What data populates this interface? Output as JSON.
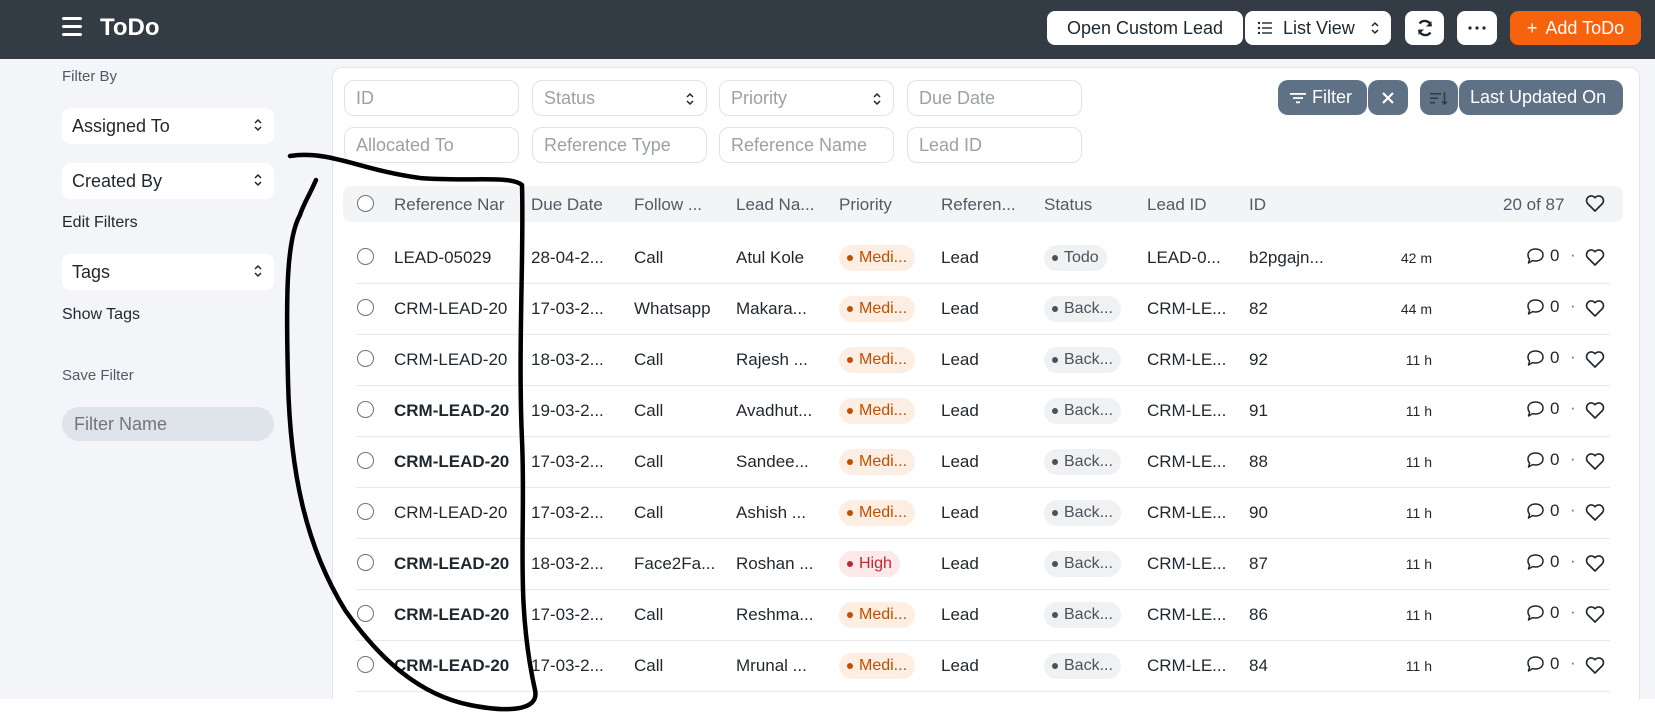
{
  "header": {
    "title": "ToDo",
    "open_custom_lead": "Open Custom Lead",
    "list_view": "List View",
    "add_todo": "Add ToDo",
    "add_icon": "+"
  },
  "sidebar": {
    "filter_by": "Filter By",
    "assigned_to": "Assigned To",
    "created_by": "Created By",
    "edit_filters": "Edit Filters",
    "tags": "Tags",
    "show_tags": "Show Tags",
    "save_filter": "Save Filter",
    "filter_name_placeholder": "Filter Name"
  },
  "filters": {
    "id": "ID",
    "status": "Status",
    "priority": "Priority",
    "due_date": "Due Date",
    "allocated_to": "Allocated To",
    "reference_type": "Reference Type",
    "reference_name": "Reference Name",
    "lead_id": "Lead ID",
    "filter_button": "Filter",
    "sort_label": "Last Updated On"
  },
  "table": {
    "columns": [
      "Reference Nar",
      "Due Date",
      "Follow ...",
      "Lead Na...",
      "Priority",
      "Referen...",
      "Status",
      "Lead ID",
      "ID"
    ],
    "count": "20 of 87",
    "rows": [
      {
        "ref": "LEAD-05029",
        "bold": false,
        "due": "28-04-2...",
        "follow": "Call",
        "lead": "Atul Kole",
        "priority": "Medi...",
        "pri_level": "med",
        "reftype": "Lead",
        "status": "Todo",
        "leadid": "LEAD-0...",
        "id": "b2pgajn...",
        "time": "42 m",
        "comments": "0"
      },
      {
        "ref": "CRM-LEAD-20",
        "bold": false,
        "due": "17-03-2...",
        "follow": "Whatsapp",
        "lead": "Makara...",
        "priority": "Medi...",
        "pri_level": "med",
        "reftype": "Lead",
        "status": "Back...",
        "leadid": "CRM-LE...",
        "id": "82",
        "time": "44 m",
        "comments": "0"
      },
      {
        "ref": "CRM-LEAD-20",
        "bold": false,
        "due": "18-03-2...",
        "follow": "Call",
        "lead": "Rajesh ...",
        "priority": "Medi...",
        "pri_level": "med",
        "reftype": "Lead",
        "status": "Back...",
        "leadid": "CRM-LE...",
        "id": "92",
        "time": "11 h",
        "comments": "0"
      },
      {
        "ref": "CRM-LEAD-20",
        "bold": true,
        "due": "19-03-2...",
        "follow": "Call",
        "lead": "Avadhut...",
        "priority": "Medi...",
        "pri_level": "med",
        "reftype": "Lead",
        "status": "Back...",
        "leadid": "CRM-LE...",
        "id": "91",
        "time": "11 h",
        "comments": "0"
      },
      {
        "ref": "CRM-LEAD-20",
        "bold": true,
        "due": "17-03-2...",
        "follow": "Call",
        "lead": "Sandee...",
        "priority": "Medi...",
        "pri_level": "med",
        "reftype": "Lead",
        "status": "Back...",
        "leadid": "CRM-LE...",
        "id": "88",
        "time": "11 h",
        "comments": "0"
      },
      {
        "ref": "CRM-LEAD-20",
        "bold": false,
        "due": "17-03-2...",
        "follow": "Call",
        "lead": "Ashish ...",
        "priority": "Medi...",
        "pri_level": "med",
        "reftype": "Lead",
        "status": "Back...",
        "leadid": "CRM-LE...",
        "id": "90",
        "time": "11 h",
        "comments": "0"
      },
      {
        "ref": "CRM-LEAD-20",
        "bold": true,
        "due": "18-03-2...",
        "follow": "Face2Fa...",
        "lead": "Roshan ...",
        "priority": "High",
        "pri_level": "high",
        "reftype": "Lead",
        "status": "Back...",
        "leadid": "CRM-LE...",
        "id": "87",
        "time": "11 h",
        "comments": "0"
      },
      {
        "ref": "CRM-LEAD-20",
        "bold": true,
        "due": "17-03-2...",
        "follow": "Call",
        "lead": "Reshma...",
        "priority": "Medi...",
        "pri_level": "med",
        "reftype": "Lead",
        "status": "Back...",
        "leadid": "CRM-LE...",
        "id": "86",
        "time": "11 h",
        "comments": "0"
      },
      {
        "ref": "CRM-LEAD-20",
        "bold": true,
        "due": "17-03-2...",
        "follow": "Call",
        "lead": "Mrunal ...",
        "priority": "Medi...",
        "pri_level": "med",
        "reftype": "Lead",
        "status": "Back...",
        "leadid": "CRM-LE...",
        "id": "84",
        "time": "11 h",
        "comments": "0"
      }
    ]
  },
  "colors": {
    "topbar": "#333c44",
    "primary": "#f7630c",
    "pill": "#5f7184"
  },
  "icons": {
    "menu": "hamburger-icon",
    "refresh": "refresh-icon",
    "more": "ellipsis-icon",
    "list": "list-icon",
    "filter": "filter-icon",
    "clear": "close-icon",
    "sort": "sort-icon",
    "comment": "comment-icon",
    "like": "heart-icon"
  }
}
